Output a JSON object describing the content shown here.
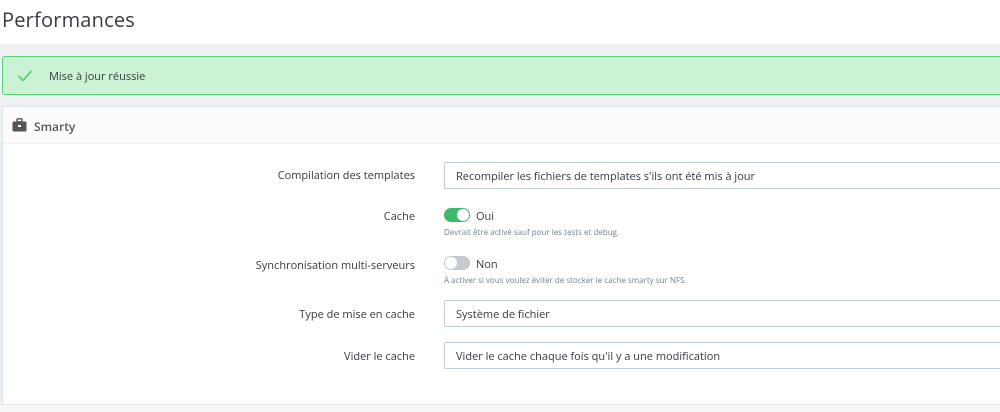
{
  "page": {
    "title": "Performances"
  },
  "alert": {
    "message": "Mise à jour réussie",
    "icon": "check-icon",
    "color": "#53d572"
  },
  "panel": {
    "title": "Smarty",
    "icon": "briefcase-icon"
  },
  "form": {
    "compilation": {
      "label": "Compilation des templates",
      "value": "Recompiler les fichiers de templates s'ils ont été mis à jour"
    },
    "cache": {
      "label": "Cache",
      "enabled": true,
      "state_label": "Oui",
      "help": "Devrait être activé sauf pour les tests et debug."
    },
    "multi_server": {
      "label": "Synchronisation multi-serveurs",
      "enabled": false,
      "state_label": "Non",
      "help": "À activer si vous voulez éviter de stocker le cache smarty sur NFS."
    },
    "cache_type": {
      "label": "Type de mise en cache",
      "value": "Système de fichier"
    },
    "clear_cache": {
      "label": "Vider le cache",
      "value": "Vider le cache chaque fois qu'il y a une modification"
    }
  },
  "colors": {
    "accent": "#3db96b",
    "switch_off": "#c4cbd0",
    "field_border": "#bbcdd2",
    "alert_bg": "#cbf2d4"
  }
}
